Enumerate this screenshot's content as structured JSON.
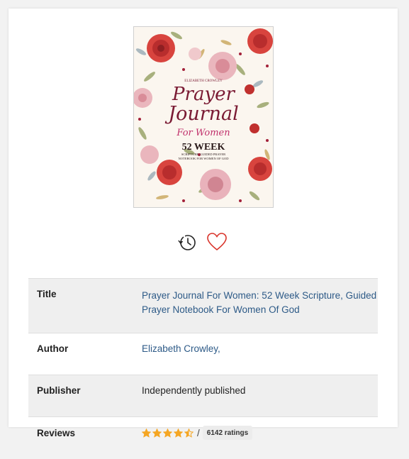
{
  "book": {
    "cover": {
      "author": "ELIZABETH CROWLEY",
      "title_line1": "Prayer",
      "title_line2": "Journal",
      "title_line3": "For Women",
      "weeks": "52 WEEK",
      "subtitle_line1": "SCRIPTURE, GUIDED PRAYER",
      "subtitle_line2": "NOTEBOOK FOR WOMEN OF GOD"
    }
  },
  "actions": {
    "history_icon": "history-icon",
    "wishlist_icon": "heart-icon"
  },
  "details": {
    "title_label": "Title",
    "title_value": "Prayer Journal For Women: 52 Week Scripture, Guided Prayer Notebook For Women Of God",
    "author_label": "Author",
    "author_value": "Elizabeth Crowley,",
    "publisher_label": "Publisher",
    "publisher_value": "Independently published",
    "reviews_label": "Reviews",
    "rating_stars": 4.5,
    "rating_separator": "/",
    "ratings_count": "6142 ratings"
  },
  "colors": {
    "link": "#2d5a87",
    "star": "#f5a623",
    "heart": "#d9342b",
    "row_shade": "#efefef"
  }
}
